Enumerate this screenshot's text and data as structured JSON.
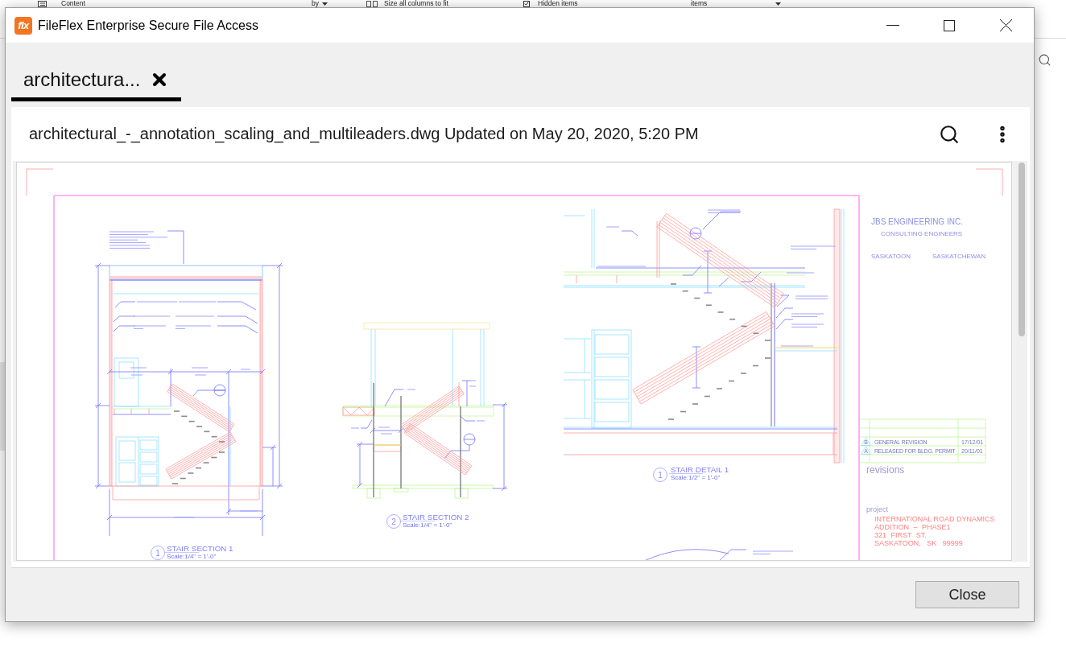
{
  "desktop": {
    "ribbon": [
      {
        "kind": "view-option",
        "label": "Content"
      },
      {
        "kind": "sort-dropdown",
        "label": "by"
      },
      {
        "kind": "command",
        "label": "Size all columns to fit"
      },
      {
        "kind": "checkbox",
        "label": "Hidden items",
        "checked": true
      },
      {
        "kind": "label",
        "label": "items"
      },
      {
        "kind": "menu-caret"
      }
    ]
  },
  "window": {
    "logo_text": "flx",
    "title": "FileFlex Enterprise Secure File Access"
  },
  "tabs": [
    {
      "label": "architectura...",
      "selected": true
    }
  ],
  "file_bar": {
    "title": "architectural_-_annotation_scaling_and_multileaders.dwg Updated on May 20, 2020, 5:20 PM"
  },
  "drawing": {
    "views": [
      {
        "number": "1",
        "title": "STAIR SECTION 1",
        "scale": "Scale:1/4\" = 1'-0\""
      },
      {
        "number": "2",
        "title": "STAIR SECTION 2",
        "scale": "Scale:1/4\" = 1'-0\""
      },
      {
        "number": "1",
        "title": "STAIR DETAIL 1",
        "scale": "Scale:1/2\" = 1'-0\""
      }
    ],
    "title_block": {
      "company": "JBS ENGINEERING INC.",
      "tagline": "CONSULTING ENGINEERS",
      "city": "SASKATOON",
      "province": "SASKATCHEWAN",
      "revisions": [
        {
          "mark": "B",
          "description": "GENERAL REVISION",
          "date": "17/12/01"
        },
        {
          "mark": "A",
          "description": "RELEASED FOR BLDG. PERMIT",
          "date": "20/11/01"
        }
      ],
      "revisions_label": "revisions",
      "project_label": "project",
      "project_lines": [
        "INTERNATIONAL ROAD DYNAMICS",
        "ADDITION – PHASE1",
        "321 FIRST ST.",
        "SASKATOON, SK 99999"
      ]
    }
  },
  "buttons": [
    {
      "label": "Close"
    }
  ]
}
